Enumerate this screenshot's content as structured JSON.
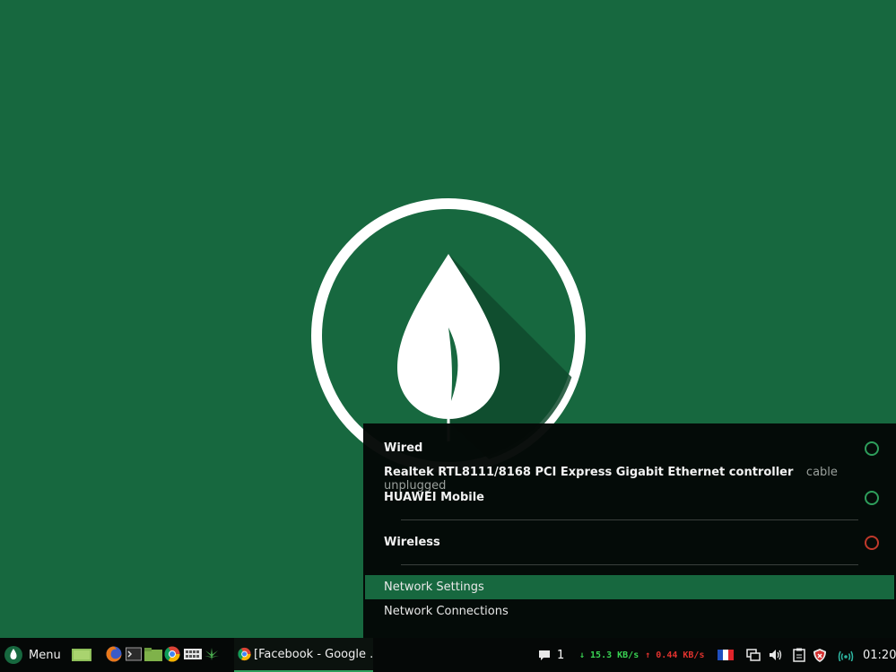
{
  "network_menu": {
    "sections": [
      {
        "label": "Wired",
        "status_color": "#2e9e5b"
      },
      {
        "label": "HUAWEI Mobile",
        "status_color": "#2e9e5b"
      },
      {
        "label": "Wireless",
        "status_color": "#c0392b"
      }
    ],
    "wired_device": {
      "name": "Realtek RTL8111/8168 PCI Express Gigabit Ethernet controller",
      "status": "cable unplugged"
    },
    "actions": [
      {
        "label": "Network Settings"
      },
      {
        "label": "Network Connections"
      }
    ]
  },
  "taskbar": {
    "menu_label": "Menu",
    "launchers": [
      "files-icon",
      "firefox-icon",
      "terminal-icon",
      "folder-icon",
      "chrome-icon",
      "grid-app-icon",
      "leaf-app-icon"
    ],
    "window": {
      "title": "[Facebook - Google ...",
      "icon": "chrome-icon"
    },
    "tray": {
      "notification_count": "1",
      "download_speed": "↓ 15.3 KB/s",
      "upload_speed": "↑ 0.44 KB/s",
      "keyboard_layout_icon": "france-flag-icon",
      "clock": "01:20"
    }
  },
  "colors": {
    "desktop_bg": "#17683f",
    "accent": "#2e9e5b",
    "error": "#c0392b",
    "download": "#39d353",
    "upload": "#e0322e"
  }
}
